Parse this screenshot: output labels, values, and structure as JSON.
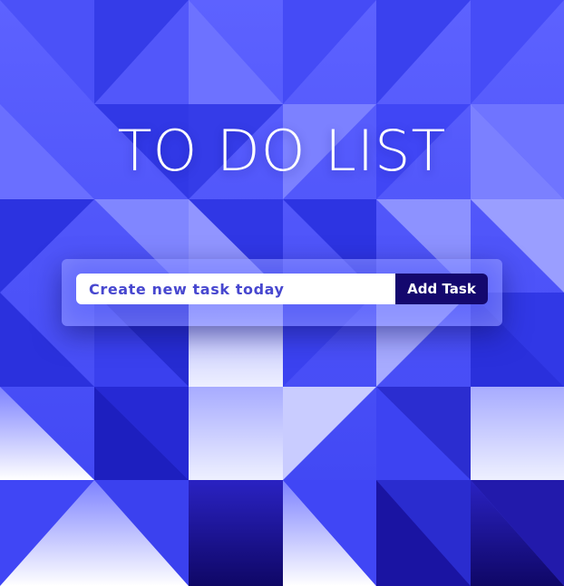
{
  "page": {
    "title": "TO DO LIST"
  },
  "form": {
    "input_placeholder": "Create new task today",
    "input_value": "",
    "add_button_label": "Add Task"
  },
  "colors": {
    "base_blue": "#4046f5",
    "mid_blue": "#5a60fb",
    "light_blue": "#8c91ff",
    "dark_blue": "#2424b8",
    "navy": "#13097a",
    "white": "#ffffff",
    "button_bg": "#14086e",
    "input_text": "#4747cf"
  }
}
